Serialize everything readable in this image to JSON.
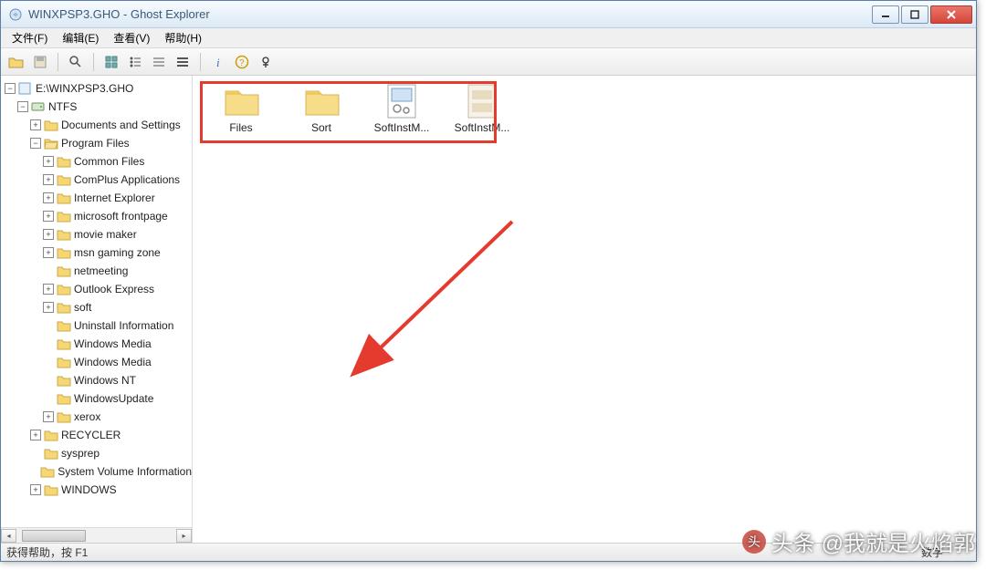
{
  "window": {
    "title": "WINXPSP3.GHO - Ghost Explorer"
  },
  "menu": {
    "file": "文件(F)",
    "edit": "编辑(E)",
    "view": "查看(V)",
    "help": "帮助(H)"
  },
  "tree": {
    "root": "E:\\WINXPSP3.GHO",
    "ntfs": "NTFS",
    "docs": "Documents and Settings",
    "pf": "Program Files",
    "pf_children": {
      "common": "Common Files",
      "complus": "ComPlus Applications",
      "ie": "Internet Explorer",
      "frontpage": "microsoft frontpage",
      "movie": "movie maker",
      "msn": "msn gaming zone",
      "netmeeting": "netmeeting",
      "outlook": "Outlook Express",
      "soft": "soft",
      "uninstall": "Uninstall Information",
      "wm1": "Windows Media",
      "wm2": "Windows Media",
      "winnt": "Windows NT",
      "winupdate": "WindowsUpdate",
      "xerox": "xerox"
    },
    "recycler": "RECYCLER",
    "sysprep": "sysprep",
    "svi": "System Volume Information",
    "windows": "WINDOWS"
  },
  "list": {
    "items": [
      {
        "name": "Files",
        "type": "folder"
      },
      {
        "name": "Sort",
        "type": "folder"
      },
      {
        "name": "SoftInstM...",
        "type": "file-config"
      },
      {
        "name": "SoftInstM...",
        "type": "file-exe"
      }
    ]
  },
  "statusbar": {
    "help": "获得帮助，按 F1",
    "right": "数字"
  },
  "watermark": "头条 @我就是火焰郭"
}
